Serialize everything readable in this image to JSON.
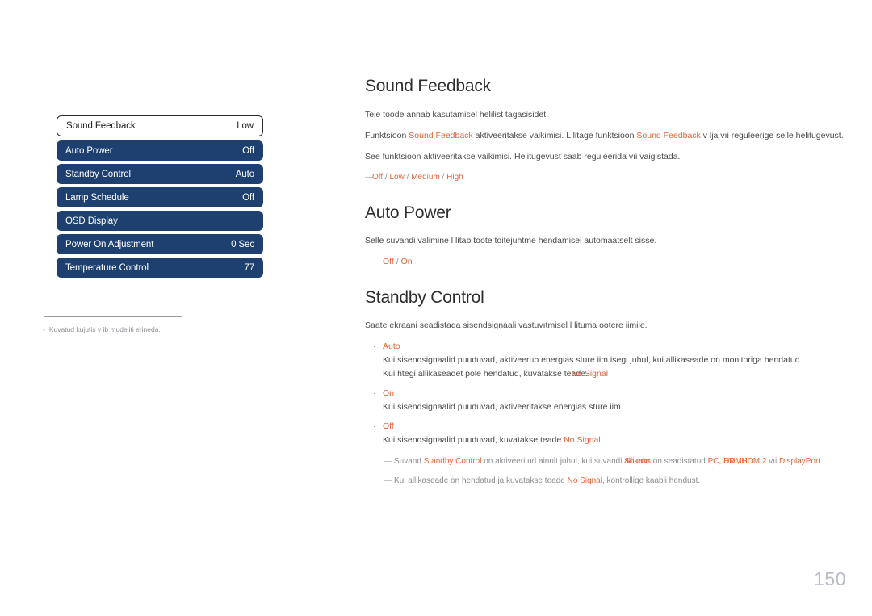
{
  "osd_menu": {
    "rows": [
      {
        "label": "Sound Feedback",
        "value": "Low",
        "selected": true
      },
      {
        "label": "Auto Power",
        "value": "Off",
        "selected": false
      },
      {
        "label": "Standby Control",
        "value": "Auto",
        "selected": false
      },
      {
        "label": "Lamp Schedule",
        "value": "Off",
        "selected": false
      },
      {
        "label": "OSD Display",
        "value": "",
        "selected": false
      },
      {
        "label": "Power On Adjustment",
        "value": "0 Sec",
        "selected": false
      },
      {
        "label": "Temperature Control",
        "value": "77",
        "selected": false
      }
    ],
    "caption_dash": "-",
    "caption": "Kuvatud kujutis v ib mudeliti erineda."
  },
  "sections": {
    "sound_feedback": {
      "heading": "Sound Feedback",
      "para1": "Teie toode annab kasutamisel helilist tagasisidet.",
      "para2_a": "Funktsioon ",
      "para2_hl1": "Sound Feedback",
      "para2_b": " aktiveeritakse vaikimisi. L litage funktsioon ",
      "para2_hl2": "Sound Feedback",
      "para2_c": " v lja vıi reguleerige selle helitugevust.",
      "para3": "See funktsioon aktiveeritakse vaikimisi. Helitugevust saab reguleerida vıi vaigistada.",
      "options_dash": "—",
      "options": [
        "Off",
        "Low",
        "Medium",
        "High"
      ],
      "options_sep": " / "
    },
    "auto_power": {
      "heading": "Auto Power",
      "para1": "Selle suvandi valimine l litab toote toitejuhtme  hendamisel automaatselt sisse.",
      "bullet_dot": "·",
      "option_a": "Off",
      "option_sep": " / ",
      "option_b": "On"
    },
    "standby_control": {
      "heading": "Standby Control",
      "para1": "Saate ekraani seadistada sisendsignaali vastuvıtmisel l lituma ootere iimile.",
      "bullet_dot": "·",
      "items": [
        {
          "title": "Auto",
          "line1": "Kui sisendsignaalid puuduvad, aktiveerub energias  sture iim isegi juhul, kui allikaseade on monitoriga  hendatud.",
          "line2_a": "Kui  htegi allikaseadet pole  hendatud, kuvatakse te",
          "line2_overlap_under": "ade",
          "line2_overlap_over": "No Signal",
          "line2_b": "."
        },
        {
          "title": "On",
          "line1": "Kui sisendsignaalid puuduvad, aktiveeritakse energias  sture iim.",
          "line2_a": "",
          "line2_overlap_under": "",
          "line2_overlap_over": "",
          "line2_b": ""
        },
        {
          "title": "Off",
          "line1_a": "Kui sisendsignaalid puuduvad, kuvatakse teade ",
          "line1_hl": "No Signal",
          "line1_b": "."
        }
      ],
      "note1": {
        "dash": "—",
        "a": "Suvand ",
        "hl1": "Standby Control",
        "b": " on aktiveeritud ainult juhul, kui suvandi ",
        "overlap_under": "allikaks",
        "overlap_over": "Source",
        "c": " on seadistatud ",
        "hl_pc": "PC",
        "comma1": ", ",
        "overlap2_under": "DVI",
        "overlap2_over": "HDMI1",
        "comma2": ", ",
        "hl_hdmi2": "HDMI2",
        "vi": " vıi ",
        "hl_dp": "DisplayPort",
        "period": "."
      },
      "note2": {
        "dash": "—",
        "a": "Kui allikaseade on  hendatud ja kuvatakse teade ",
        "hl": "No Signal",
        "b": ", kontrollige kaabli hendust."
      }
    }
  },
  "page_number": "150",
  "colors": {
    "osd_row_bg": "#1d4071",
    "highlight": "#e8633a",
    "body_text": "#4a4a4a",
    "muted": "#8c8c92",
    "page_number": "#b9bcc6"
  }
}
